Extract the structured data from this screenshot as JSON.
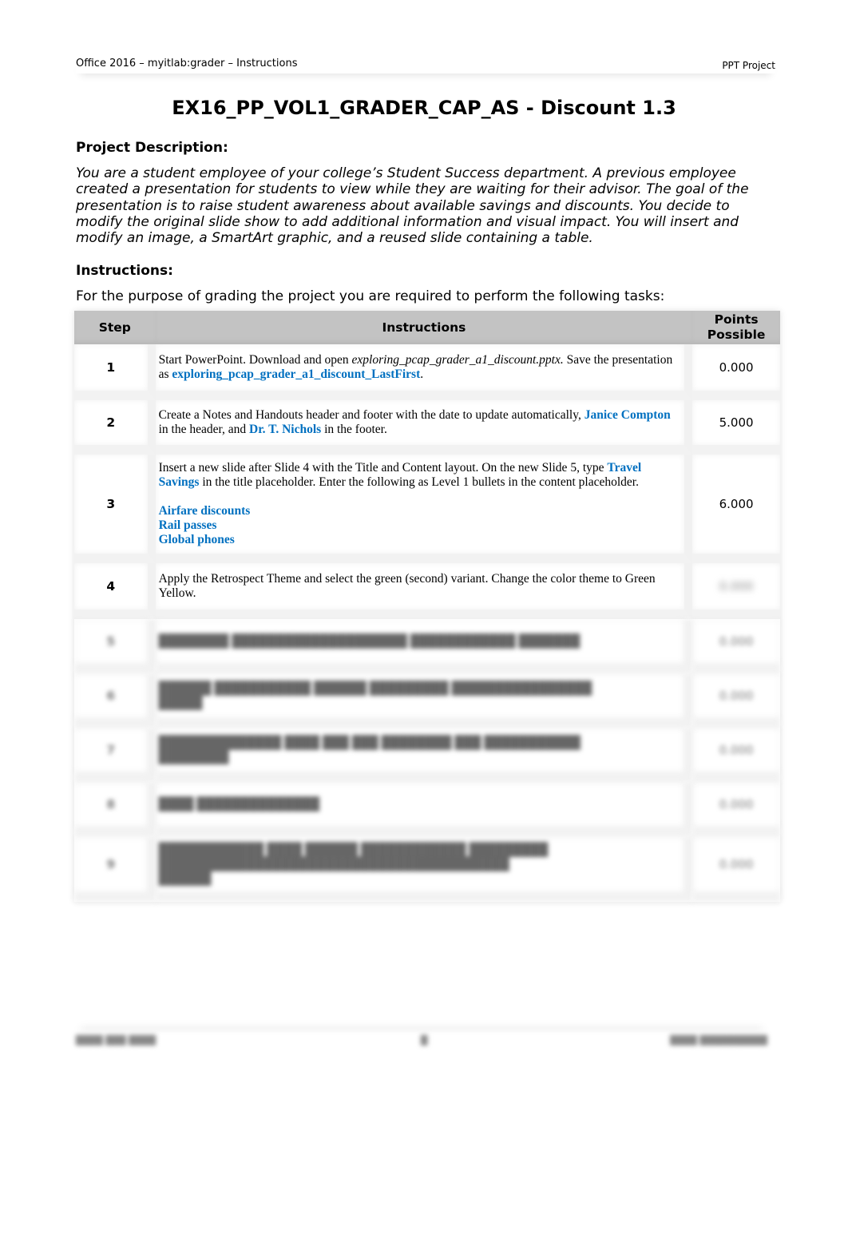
{
  "header": {
    "left": "Office 2016 – myitlab:grader – Instructions",
    "right": "PPT Project"
  },
  "title": "EX16_PP_VOL1_GRADER_CAP_AS - Discount 1.3",
  "description": {
    "heading": "Project Description:",
    "text": "You are a student employee of your college’s Student Success department. A previous employee created a presentation for students to view while they are waiting for their advisor. The goal of the presentation is to raise student awareness about available savings and discounts. You decide to modify the original slide show to add additional information and visual impact. You will insert and modify an image, a SmartArt graphic, and a reused slide containing a table."
  },
  "instructions": {
    "heading": "Instructions:",
    "intro": "For the purpose of grading the project you are required to perform the following tasks:"
  },
  "table": {
    "headers": {
      "step": "Step",
      "instructions": "Instructions",
      "points_line1": "Points",
      "points_line2": "Possible"
    },
    "rows": [
      {
        "step": "1",
        "t1": "Start PowerPoint. Download and open ",
        "t2": "exploring_pcap_grader_a1_discount.pptx.",
        "t3": " Save the presentation as ",
        "t4": "exploring_pcap_grader_a1_discount_LastFirst",
        "t5": ".",
        "points": "0.000"
      },
      {
        "step": "2",
        "t1": "Create a Notes and Handouts header and footer with the date to update automatically, ",
        "t2": "Janice Compton",
        "t3": " in the header, and ",
        "t4": "Dr. T. Nichols",
        "t5": " in the footer.",
        "points": "5.000"
      },
      {
        "step": "3",
        "t1": "Insert a new slide after Slide 4 with the Title and Content layout. On the new Slide 5, type ",
        "t2": "Travel Savings",
        "t3": " in the title placeholder. Enter the following as Level 1 bullets in the content placeholder.",
        "bullets": [
          "Airfare discounts",
          "Rail passes",
          "Global phones"
        ],
        "points": "6.000"
      },
      {
        "step": "4",
        "text": "Apply the Retrospect Theme and select the green (second) variant. Change the color theme to Green Yellow.",
        "points": "(obscured)"
      }
    ],
    "obscured_rows": [
      {
        "step": "5",
        "text": "(obscured)",
        "points": "(obscured)"
      },
      {
        "step": "6",
        "text": "(obscured)",
        "points": "(obscured)"
      },
      {
        "step": "7",
        "text": "(obscured)",
        "points": "(obscured)"
      },
      {
        "step": "8",
        "text": "(obscured)",
        "points": "(obscured)"
      },
      {
        "step": "9",
        "text": "(obscured)",
        "points": "(obscured)"
      }
    ]
  },
  "footer": {
    "left": "(obscured)",
    "center": "(obscured)",
    "right": "(obscured)"
  }
}
